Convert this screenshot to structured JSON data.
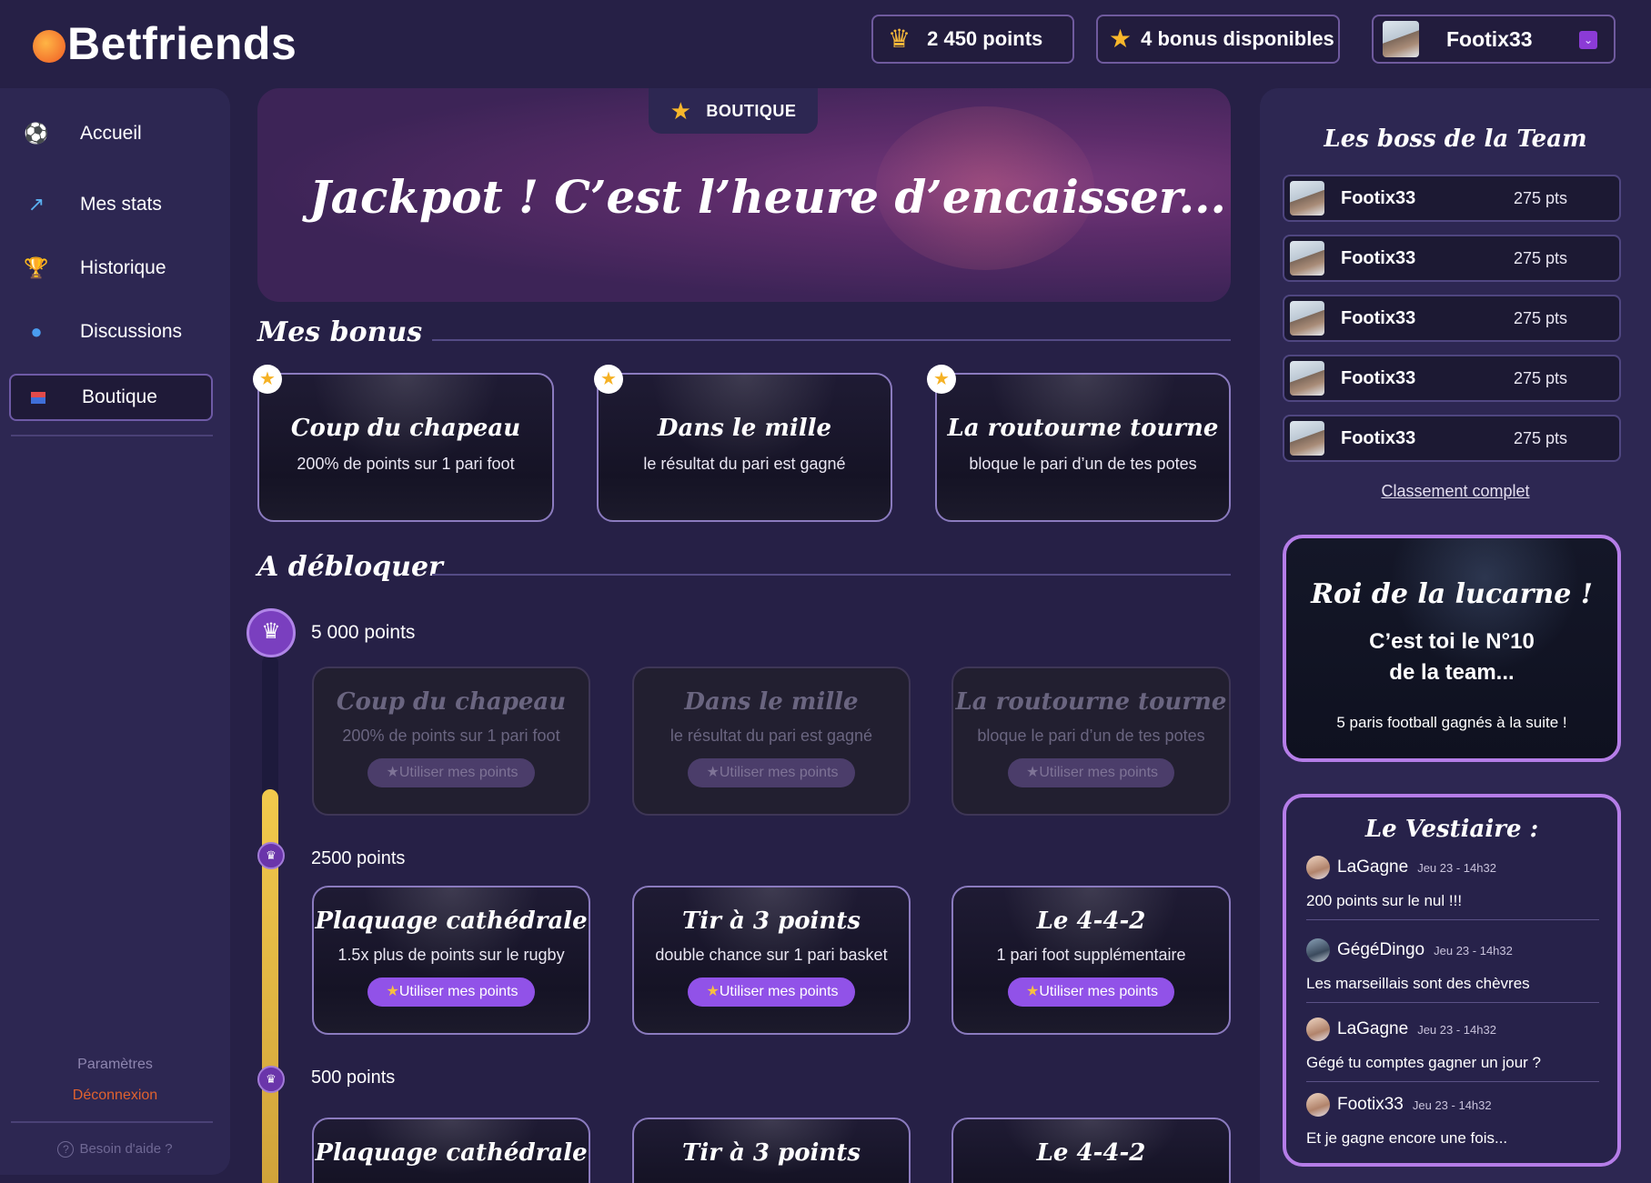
{
  "app": {
    "name": "Betfriends"
  },
  "header": {
    "points": "2 450 points",
    "bonus": "4 bonus disponibles",
    "username": "Footix33",
    "icons": {
      "points": "crown-icon",
      "bonus": "star-icon"
    }
  },
  "sidebar": {
    "items": [
      {
        "label": "Accueil",
        "icon": "football-icon"
      },
      {
        "label": "Mes stats",
        "icon": "chart-icon"
      },
      {
        "label": "Historique",
        "icon": "trophy-icon"
      },
      {
        "label": "Discussions",
        "icon": "chat-icon"
      },
      {
        "label": "Boutique",
        "icon": "shop-icon",
        "active": true
      }
    ],
    "settings": "Paramètres",
    "logout": "Déconnexion",
    "help": "Besoin d'aide ?"
  },
  "hero": {
    "tab_label": "BOUTIQUE",
    "title": "Jackpot ! C’est l’heure d’encaisser..."
  },
  "mes_bonus": {
    "heading": "Mes bonus",
    "cards": [
      {
        "title": "Coup du chapeau",
        "desc": "200% de points sur 1 pari foot"
      },
      {
        "title": "Dans le mille",
        "desc": "le résultat du pari est gagné"
      },
      {
        "title": "La routourne tourne",
        "desc": "bloque le pari d’un de tes potes"
      }
    ]
  },
  "a_debloquer": {
    "heading": "A débloquer",
    "button_label": "Utiliser mes points",
    "tiers": [
      {
        "points": "5 000 points",
        "locked": true,
        "cards": [
          {
            "title": "Coup du chapeau",
            "desc": "200% de points sur 1 pari foot"
          },
          {
            "title": "Dans le mille",
            "desc": "le résultat du pari est gagné"
          },
          {
            "title": "La routourne tourne",
            "desc": "bloque le pari d’un de tes potes"
          }
        ]
      },
      {
        "points": "2500 points",
        "locked": false,
        "cards": [
          {
            "title": "Plaquage cathédrale",
            "desc": "1.5x plus de points sur le rugby"
          },
          {
            "title": "Tir à 3 points",
            "desc": "double chance sur 1 pari basket"
          },
          {
            "title": "Le 4-4-2",
            "desc": "1 pari foot supplémentaire"
          }
        ]
      },
      {
        "points": "500 points",
        "locked": false,
        "cards": [
          {
            "title": "Plaquage cathédrale"
          },
          {
            "title": "Tir à 3 points"
          },
          {
            "title": "Le 4-4-2"
          }
        ]
      }
    ]
  },
  "leaderboard": {
    "title": "Les boss de la Team",
    "rows": [
      {
        "name": "Footix33",
        "pts": "275 pts"
      },
      {
        "name": "Footix33",
        "pts": "275 pts"
      },
      {
        "name": "Footix33",
        "pts": "275 pts"
      },
      {
        "name": "Footix33",
        "pts": "275 pts"
      },
      {
        "name": "Footix33",
        "pts": "275 pts"
      }
    ],
    "full_link": "Classement complet"
  },
  "roi": {
    "title": "Roi de la lucarne !",
    "line1": "C’est toi le N°10",
    "line2": "de la team...",
    "footer": "5 paris football gagnés à la suite !"
  },
  "vestiaire": {
    "title": "Le Vestiaire :",
    "messages": [
      {
        "name": "LaGagne",
        "time": "Jeu 23 - 14h32",
        "text": "200 points sur le nul !!!"
      },
      {
        "name": "GégéDingo",
        "time": "Jeu 23 - 14h32",
        "text": "Les marseillais sont des chèvres"
      },
      {
        "name": "LaGagne",
        "time": "Jeu 23 - 14h32",
        "text": "Gégé tu comptes gagner un jour ?"
      },
      {
        "name": "Footix33",
        "time": "Jeu 23 - 14h32",
        "text": "Et je gagne encore une fois..."
      }
    ]
  },
  "colors": {
    "background": "#262046",
    "panel": "#2d2752",
    "accent": "#9152e8",
    "gold": "#f2c94c",
    "danger": "#e0622f"
  }
}
